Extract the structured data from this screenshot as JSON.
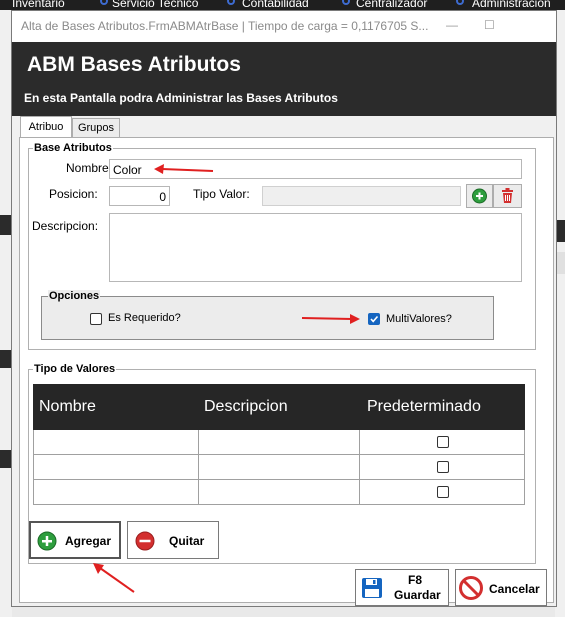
{
  "background": {
    "menu": [
      {
        "label": "Inventario"
      },
      {
        "label": "Servicio Tecnico"
      },
      {
        "label": "Contabilidad"
      },
      {
        "label": "Centralizador"
      },
      {
        "label": "Administracion"
      }
    ]
  },
  "window": {
    "title": "Alta de Bases Atributos.FrmABMAtrBase | Tiempo de carga = 0,1176705 S...",
    "minimize_glyph": "—",
    "maximize_glyph": "☐"
  },
  "header": {
    "title": "ABM Bases Atributos",
    "subtitle": "En esta Pantalla podra Administrar las Bases Atributos"
  },
  "tabs": [
    {
      "label": "Atribuo",
      "active": true
    },
    {
      "label": "Grupos",
      "active": false
    }
  ],
  "base_atributos": {
    "legend": "Base Atributos",
    "nombre_label": "Nombre:",
    "nombre_value": "Color",
    "posicion_label": "Posicion:",
    "posicion_value": "0",
    "tipo_valor_label": "Tipo Valor:",
    "tipo_valor_value": "",
    "descripcion_label": "Descripcion:",
    "descripcion_value": ""
  },
  "opciones": {
    "legend": "Opciones",
    "es_requerido_label": "Es Requerido?",
    "es_requerido_checked": false,
    "multivalores_label": "MultiValores?",
    "multivalores_checked": true
  },
  "tipo_valores": {
    "legend": "Tipo de Valores",
    "columns": [
      "Nombre",
      "Descripcion",
      "Predeterminado"
    ],
    "rows": [
      {
        "nombre": "",
        "descripcion": "",
        "predeterminado": false
      },
      {
        "nombre": "",
        "descripcion": "",
        "predeterminado": false
      },
      {
        "nombre": "",
        "descripcion": "",
        "predeterminado": false
      }
    ]
  },
  "buttons": {
    "agregar": "Agregar",
    "quitar": "Quitar",
    "guardar_key": "F8",
    "guardar": "Guardar",
    "cancelar": "Cancelar"
  },
  "colors": {
    "header_bg": "#2b2b2b",
    "accent_green": "#2e9e3e",
    "accent_red": "#d32f2f",
    "checkbox_blue": "#1565c0",
    "annotation_red": "#e02020"
  }
}
